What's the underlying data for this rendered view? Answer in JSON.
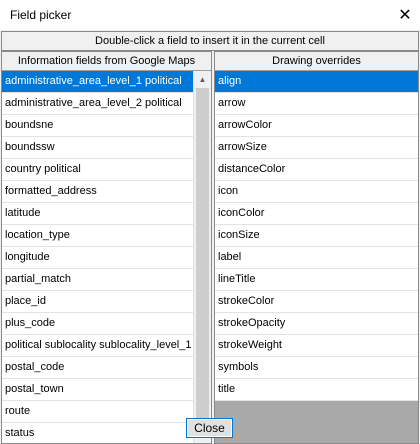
{
  "window": {
    "title": "Field picker",
    "close_glyph": "✕"
  },
  "banner": {
    "text": "Double-click a field to insert it in the current cell"
  },
  "left_panel": {
    "header": "Information fields from Google Maps",
    "items": [
      "administrative_area_level_1 political",
      "administrative_area_level_2 political",
      "boundsne",
      "boundssw",
      "country political",
      "formatted_address",
      "latitude",
      "location_type",
      "longitude",
      "partial_match",
      "place_id",
      "plus_code",
      "political sublocality sublocality_level_1",
      "postal_code",
      "postal_town",
      "route",
      "status"
    ],
    "selected_index": 0
  },
  "right_panel": {
    "header": "Drawing overrides",
    "items": [
      "align",
      "arrow",
      "arrowColor",
      "arrowSize",
      "distanceColor",
      "icon",
      "iconColor",
      "iconSize",
      "label",
      "lineTitle",
      "strokeColor",
      "strokeOpacity",
      "strokeWeight",
      "symbols",
      "title"
    ],
    "selected_index": 0
  },
  "buttons": {
    "close_label": "Close"
  },
  "icons": {
    "scroll_up": "▲"
  },
  "colors": {
    "selection": "#0078d7",
    "empty_area": "#a9a9a9"
  }
}
